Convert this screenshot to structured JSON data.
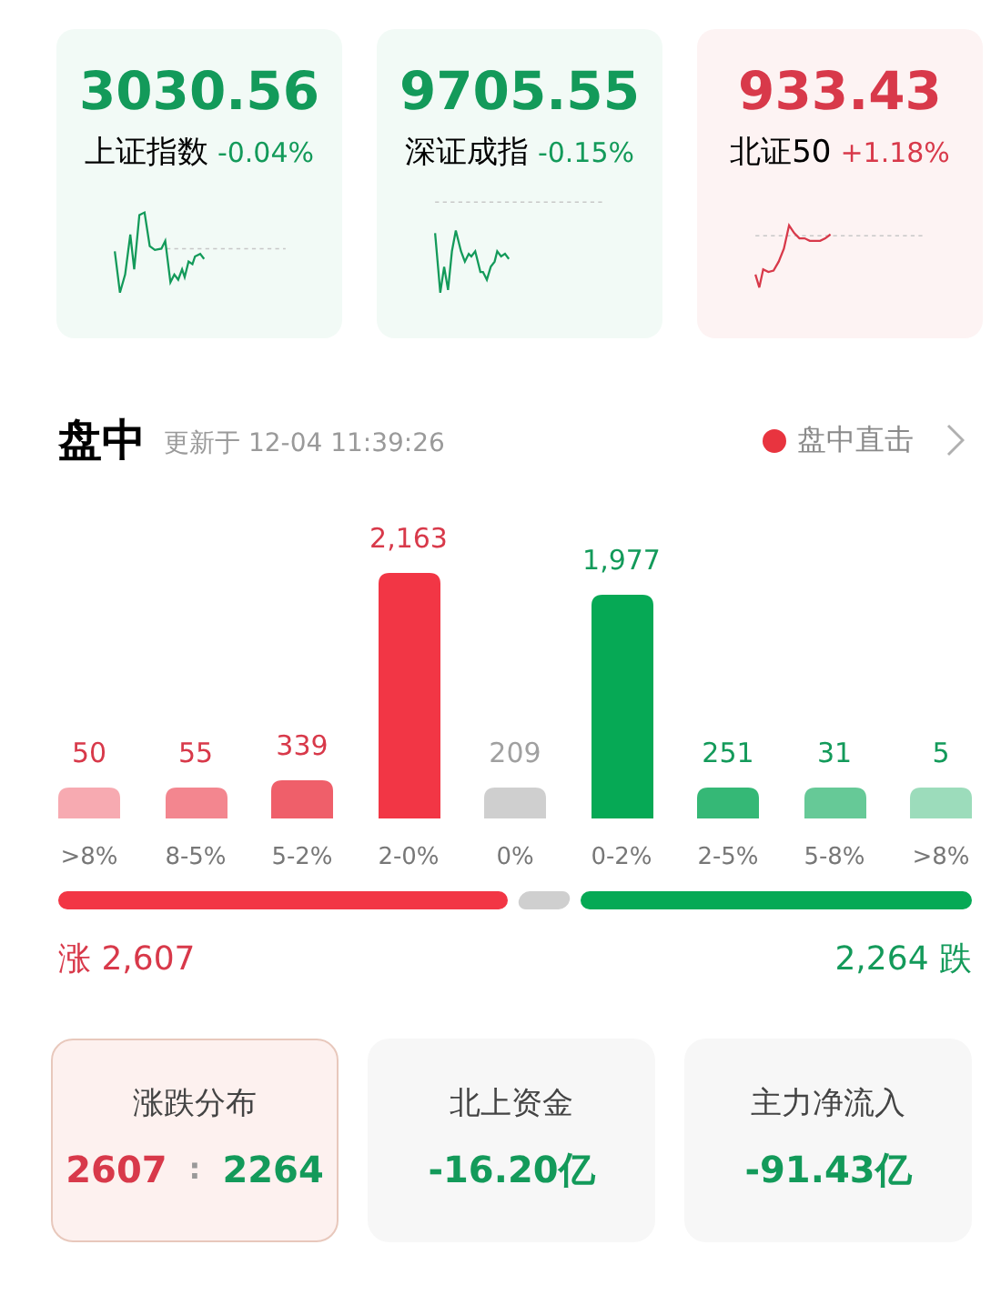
{
  "index_cards": [
    {
      "value": "3030.56",
      "name": "上证指数",
      "change": "-0.04%",
      "color": "#139a5a"
    },
    {
      "value": "9705.55",
      "name": "深证成指",
      "change": "-0.15%",
      "color": "#139a5a"
    },
    {
      "value": "933.43",
      "name": "北证50",
      "change": "+1.18%",
      "color": "#d8394a"
    }
  ],
  "section": {
    "title": "盘中",
    "updated": "更新于 12-04 11:39:26",
    "live_link": "盘中直击"
  },
  "distribution": {
    "bars": [
      {
        "count": "50",
        "category": ">8%",
        "color": "#f7aab1"
      },
      {
        "count": "55",
        "category": "8-5%",
        "color": "#f3868f"
      },
      {
        "count": "339",
        "category": "5-2%",
        "color": "#ef5f6a"
      },
      {
        "count": "2,163",
        "category": "2-0%",
        "color": "#f23645"
      },
      {
        "count": "209",
        "category": "0%",
        "color": "#cfcfcf"
      },
      {
        "count": "1,977",
        "category": "0-2%",
        "color": "#06a955"
      },
      {
        "count": "251",
        "category": "2-5%",
        "color": "#35b876"
      },
      {
        "count": "31",
        "category": "5-8%",
        "color": "#66c997"
      },
      {
        "count": "5",
        "category": ">8%",
        "color": "#9cdcbb"
      }
    ],
    "rise_label": "涨",
    "rise_total": "2,607",
    "fall_total": "2,264",
    "fall_label": "跌"
  },
  "stat_cards": [
    {
      "title": "涨跌分布",
      "kind": "ratio",
      "up": "2607",
      "sep": ":",
      "down": "2264",
      "selected": true
    },
    {
      "title": "北上资金",
      "kind": "value",
      "value": "-16.20亿",
      "selected": false
    },
    {
      "title": "主力净流入",
      "kind": "value",
      "value": "-91.43亿",
      "selected": false
    }
  ]
}
